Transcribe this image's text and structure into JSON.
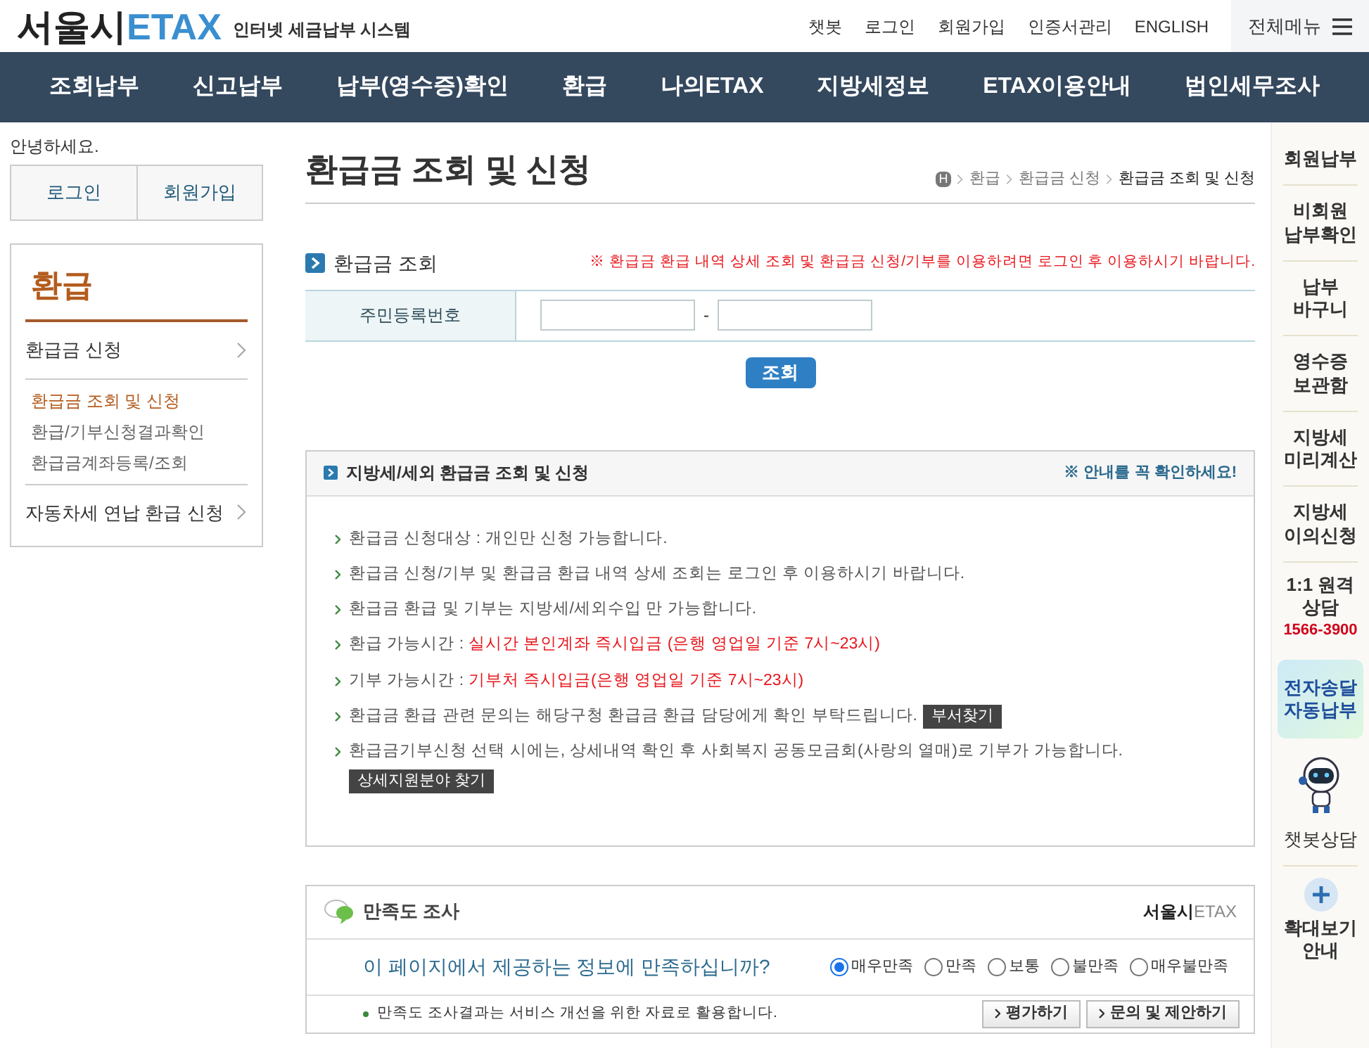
{
  "header": {
    "logo_main": "서울시",
    "logo_accent": "ETAX",
    "tagline": "인터넷 세금납부 시스템",
    "links": [
      "챗봇",
      "로그인",
      "회원가입",
      "인증서관리",
      "ENGLISH"
    ],
    "all_menu": "전체메뉴"
  },
  "nav": [
    "조회납부",
    "신고납부",
    "납부(영수증)확인",
    "환급",
    "나의ETAX",
    "지방세정보",
    "ETAX이용안내",
    "법인세무조사"
  ],
  "sidebar": {
    "greeting": "안녕하세요.",
    "auth_buttons": [
      "로그인",
      "회원가입"
    ],
    "title": "환급",
    "items": [
      {
        "label": "환급금 신청",
        "children": [
          {
            "label": "환급금 조회 및 신청",
            "selected": true
          },
          {
            "label": "환급/기부신청결과확인",
            "selected": false
          },
          {
            "label": "환급금계좌등록/조회",
            "selected": false
          }
        ]
      },
      {
        "label": "자동차세 연납 환급 신청"
      }
    ]
  },
  "page_title": "환급금 조회 및 신청",
  "breadcrumb": [
    "H",
    "환급",
    "환급금 신청",
    "환급금 조회 및 신청"
  ],
  "lookup": {
    "title": "환급금 조회",
    "warning": "※ 환급금 환급 내역 상세 조회 및 환급금 신청/기부를 이용하려면 로그인 후 이용하시기 바랍니다.",
    "field_label": "주민등록번호",
    "separator": "-",
    "button": "조회"
  },
  "info": {
    "title": "지방세/세외 환급금 조회 및 신청",
    "notice": "※ 안내를 꼭 확인하세요!",
    "items": [
      {
        "segments": [
          {
            "text": "환급금 신청대상 : 개인만 신청 가능합니다.",
            "highlight": false
          }
        ]
      },
      {
        "segments": [
          {
            "text": "환급금 신청/기부 및 환급금 환급 내역 상세 조회는 로그인 후 이용하시기 바랍니다.",
            "highlight": false
          }
        ]
      },
      {
        "segments": [
          {
            "text": "환급금 환급 및 기부는 지방세/세외수입 만 가능합니다.",
            "highlight": false
          }
        ]
      },
      {
        "segments": [
          {
            "text": "환급 가능시간 : ",
            "highlight": false
          },
          {
            "text": "실시간 본인계좌 즉시입금 (은행 영업일 기준 7시~23시)",
            "highlight": true
          }
        ]
      },
      {
        "segments": [
          {
            "text": "기부 가능시간 : ",
            "highlight": false
          },
          {
            "text": "기부처 즉시입금(은행 영업일 기준 7시~23시)",
            "highlight": true
          }
        ]
      },
      {
        "segments": [
          {
            "text": "환급금 환급 관련 문의는 해당구청 환급금 환급 담당에게 확인 부탁드립니다.",
            "highlight": false
          }
        ],
        "button": "부서찾기",
        "button_newline": false
      },
      {
        "segments": [
          {
            "text": "환급금기부신청 선택 시에는, 상세내역 확인 후 사회복지 공동모금회(사랑의 열매)로 기부가 가능합니다.",
            "highlight": false
          }
        ],
        "button": "상세지원분야 찾기",
        "button_newline": true
      }
    ]
  },
  "survey": {
    "title": "만족도 조사",
    "brand_main": "서울시",
    "brand_accent": "ETAX",
    "question": "이 페이지에서 제공하는 정보에 만족하십니까?",
    "options": [
      {
        "label": "매우만족",
        "selected": true
      },
      {
        "label": "만족",
        "selected": false
      },
      {
        "label": "보통",
        "selected": false
      },
      {
        "label": "불만족",
        "selected": false
      },
      {
        "label": "매우불만족",
        "selected": false
      }
    ],
    "note": "만족도 조사결과는 서비스 개선을 위한 자료로 활용합니다.",
    "buttons": [
      "평가하기",
      "문의 및 제안하기"
    ]
  },
  "quick_menu": [
    {
      "kind": "link",
      "label": "회원납부"
    },
    {
      "kind": "link",
      "label": "비회원\n납부확인"
    },
    {
      "kind": "link",
      "label": "납부\n바구니"
    },
    {
      "kind": "link",
      "label": "영수증\n보관함"
    },
    {
      "kind": "link",
      "label": "지방세\n미리계산"
    },
    {
      "kind": "link",
      "label": "지방세\n이의신청"
    },
    {
      "kind": "phone",
      "label": "1:1 원격\n상담",
      "phone": "1566-3900"
    },
    {
      "kind": "highlight",
      "label": "전자송달\n자동납부"
    },
    {
      "kind": "chatbot",
      "label": "챗봇상담"
    },
    {
      "kind": "zoom",
      "label": "확대보기\n안내"
    }
  ]
}
